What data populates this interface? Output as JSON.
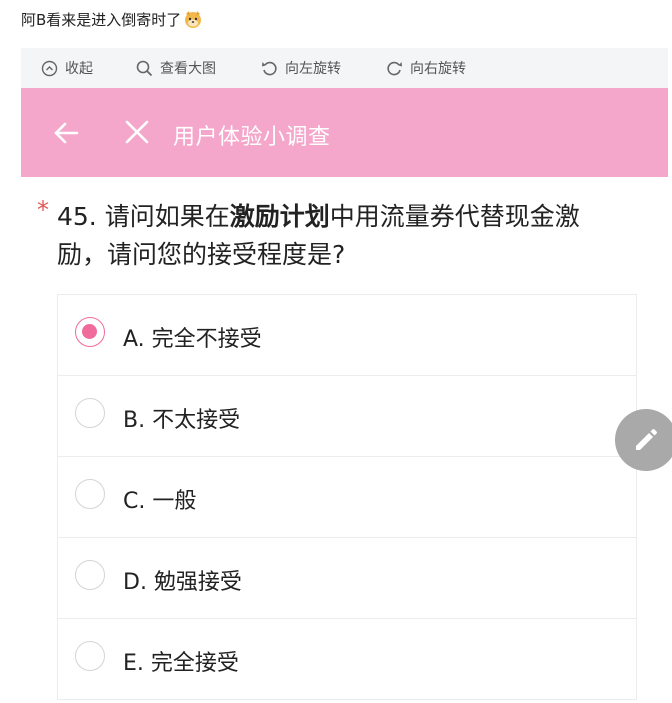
{
  "post": {
    "text": "阿B看来是进入倒寄时了",
    "emoji": "shiba-dog-face-emoji"
  },
  "toolbar": {
    "collapse_label": "收起",
    "view_large_label": "查看大图",
    "rotate_left_label": "向左旋转",
    "rotate_right_label": "向右旋转"
  },
  "header": {
    "title": "用户体验小调查",
    "background": "#f4a7cb"
  },
  "question": {
    "required_mark": "*",
    "prefix": "45. 请问如果在",
    "bold": "激励计划",
    "suffix": "中用流量券代替现金激励，请问您的接受程度是?"
  },
  "options": [
    {
      "label": "A. 完全不接受",
      "selected": true
    },
    {
      "label": "B. 不太接受",
      "selected": false
    },
    {
      "label": "C. 一般",
      "selected": false
    },
    {
      "label": "D. 勉强接受",
      "selected": false
    },
    {
      "label": "E. 完全接受",
      "selected": false
    }
  ],
  "accent_color": "#f06b9c",
  "fab": {
    "icon": "pencil-icon"
  }
}
